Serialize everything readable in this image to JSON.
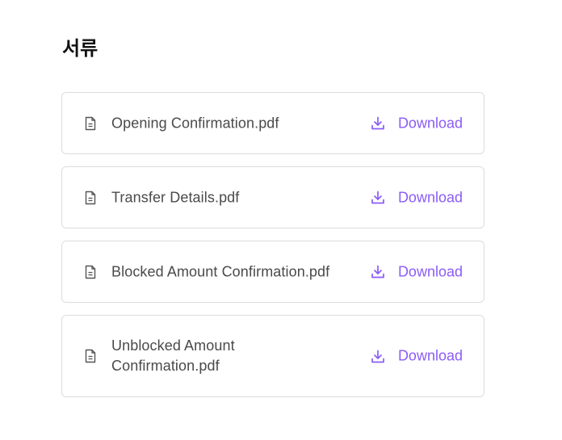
{
  "page": {
    "title": "서류"
  },
  "documents": [
    {
      "name": "Opening Confirmation.pdf",
      "action_label": "Download"
    },
    {
      "name": "Transfer Details.pdf",
      "action_label": "Download"
    },
    {
      "name": "Blocked Amount Confirmation.pdf",
      "action_label": "Download"
    },
    {
      "name": "Unblocked Amount Confirmation.pdf",
      "action_label": "Download"
    }
  ],
  "icons": {
    "file": "file-document-icon",
    "download": "download-icon"
  },
  "colors": {
    "accent": "#8b5cf6",
    "text": "#4a4a4a",
    "border": "#dcdcdc",
    "title": "#111111"
  }
}
